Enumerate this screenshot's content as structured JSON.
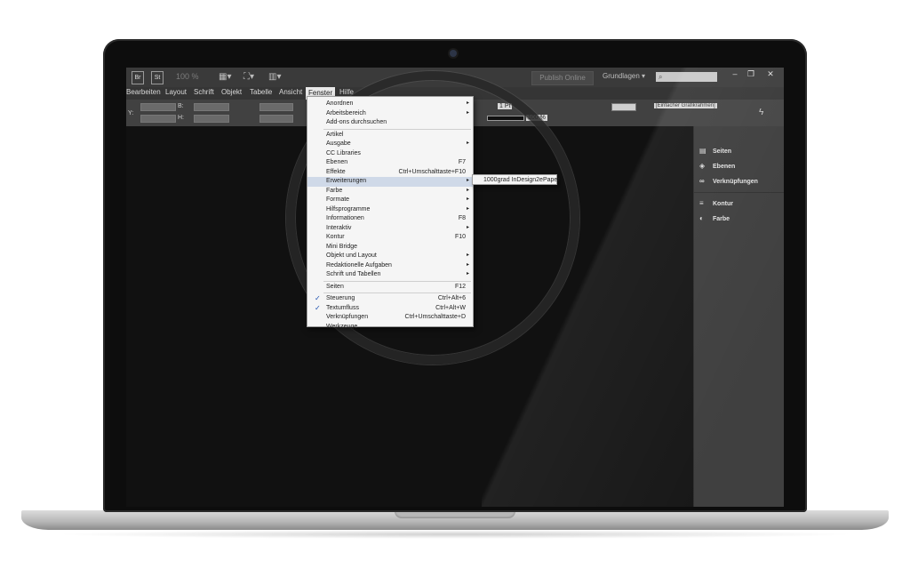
{
  "titlebar": {
    "app_badge_1": "Br",
    "app_badge_2": "St",
    "zoom": "100 %",
    "publish_label": "Publish Online",
    "workspace_label": "Grundlagen",
    "search_placeholder": ""
  },
  "menubar": {
    "items": [
      "Bearbeiten",
      "Layout",
      "Schrift",
      "Objekt",
      "Tabelle",
      "Ansicht",
      "Fenster",
      "Hilfe"
    ]
  },
  "controlbar": {
    "labels": [
      "Y:",
      "B:",
      "H:"
    ],
    "stroke_value": "1 Pt",
    "percent_value": "100 %",
    "style_value": "[Einfacher Grafikrahmen]"
  },
  "dropdown": {
    "items": [
      {
        "label": "Anordnen",
        "shortcut": "",
        "submenu": true
      },
      {
        "label": "Arbeitsbereich",
        "shortcut": "",
        "submenu": true
      },
      {
        "label": "Add-ons durchsuchen",
        "shortcut": "",
        "submenu": false
      },
      {
        "label": "Artikel",
        "shortcut": "",
        "submenu": false
      },
      {
        "label": "Ausgabe",
        "shortcut": "",
        "submenu": true
      },
      {
        "label": "CC Libraries",
        "shortcut": "",
        "submenu": false
      },
      {
        "label": "Ebenen",
        "shortcut": "F7",
        "submenu": false
      },
      {
        "label": "Effekte",
        "shortcut": "Ctrl+Umschalttaste+F10",
        "submenu": false
      },
      {
        "label": "Erweiterungen",
        "shortcut": "",
        "submenu": true,
        "highlighted": true
      },
      {
        "label": "Farbe",
        "shortcut": "",
        "submenu": true
      },
      {
        "label": "Formate",
        "shortcut": "",
        "submenu": true
      },
      {
        "label": "Hilfsprogramme",
        "shortcut": "",
        "submenu": true
      },
      {
        "label": "Informationen",
        "shortcut": "F8",
        "submenu": false
      },
      {
        "label": "Interaktiv",
        "shortcut": "",
        "submenu": true
      },
      {
        "label": "Kontur",
        "shortcut": "F10",
        "submenu": false
      },
      {
        "label": "Mini Bridge",
        "shortcut": "",
        "submenu": false
      },
      {
        "label": "Objekt und Layout",
        "shortcut": "",
        "submenu": true
      },
      {
        "label": "Redaktionelle Aufgaben",
        "shortcut": "",
        "submenu": true
      },
      {
        "label": "Schrift und Tabellen",
        "shortcut": "",
        "submenu": true
      },
      {
        "label": "Seiten",
        "shortcut": "F12",
        "submenu": false
      },
      {
        "label": "Steuerung",
        "shortcut": "Ctrl+Alt+6",
        "submenu": false,
        "checked": true
      },
      {
        "label": "Textumfluss",
        "shortcut": "Ctrl+Alt+W",
        "submenu": false,
        "checked": true
      },
      {
        "label": "Verknüpfungen",
        "shortcut": "Ctrl+Umschalttaste+D",
        "submenu": false
      },
      {
        "label": "Werkzeuge",
        "shortcut": "",
        "submenu": false
      }
    ]
  },
  "submenu": {
    "item": "1000grad InDesign2ePaper"
  },
  "panel": {
    "items": [
      "Seiten",
      "Ebenen",
      "Verknüpfungen",
      "Kontur",
      "Farbe"
    ]
  }
}
